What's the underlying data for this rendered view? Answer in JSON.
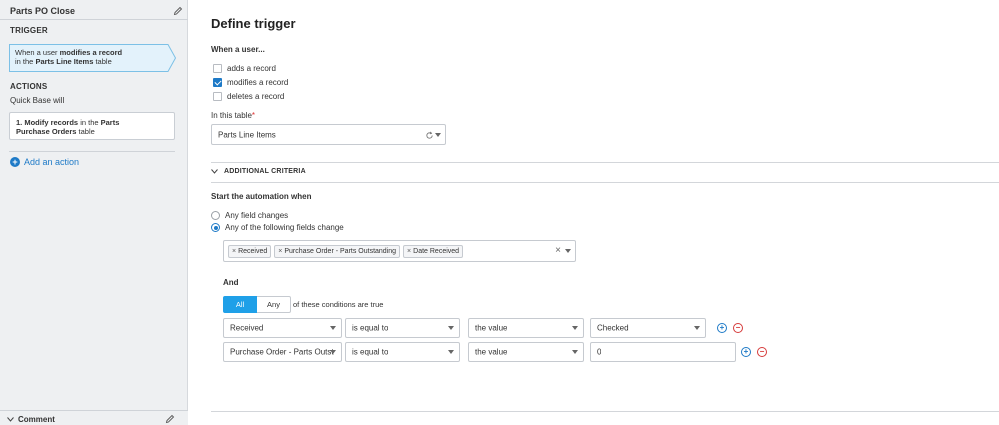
{
  "sidebar": {
    "flow_title": "Parts PO Close",
    "trigger_heading": "TRIGGER",
    "trigger_card": {
      "prefix": "When a user ",
      "action_bold": "modifies a record",
      "in_word": "in the ",
      "table_bold": "Parts Line Items",
      "suffix": " table"
    },
    "actions_heading": "ACTIONS",
    "quickbase_will": "Quick Base will",
    "action_card": {
      "number": "1. ",
      "verb_bold": "Modify records",
      "in_word": " in the ",
      "table_bold_1": "Parts",
      "table_bold_2": "Purchase Orders",
      "suffix": " table"
    },
    "add_action_label": "Add an action",
    "comment_label": "Comment"
  },
  "main": {
    "title": "Define trigger",
    "when_user_label": "When a user...",
    "events": [
      {
        "label": "adds a record",
        "checked": false
      },
      {
        "label": "modifies a record",
        "checked": true
      },
      {
        "label": "deletes a record",
        "checked": false
      }
    ],
    "in_table_label": "In this table",
    "required_mark": "*",
    "table_value": "Parts Line Items",
    "additional_criteria_label": "ADDITIONAL CRITERIA",
    "start_label": "Start the automation when",
    "start_options": [
      {
        "label": "Any field changes",
        "selected": false
      },
      {
        "label": "Any of the following fields change",
        "selected": true
      }
    ],
    "field_chips": [
      "Received",
      "Purchase Order - Parts Outstanding",
      "Date Received"
    ],
    "and_label": "And",
    "match_all_label": "All",
    "match_any_label": "Any",
    "match_note": "of these conditions are true",
    "conditions": [
      {
        "field": "Received",
        "operator": "is equal to",
        "compare": "the value",
        "value": "Checked"
      },
      {
        "field": "Purchase Order - Parts Outsta",
        "operator": "is equal to",
        "compare": "the value",
        "value": "0"
      }
    ]
  },
  "colors": {
    "accent_blue": "#1e7ac7",
    "toggle_blue": "#1fa0e8",
    "remove_red": "#d63a3a",
    "sidebar_bg": "#eef0f2"
  }
}
